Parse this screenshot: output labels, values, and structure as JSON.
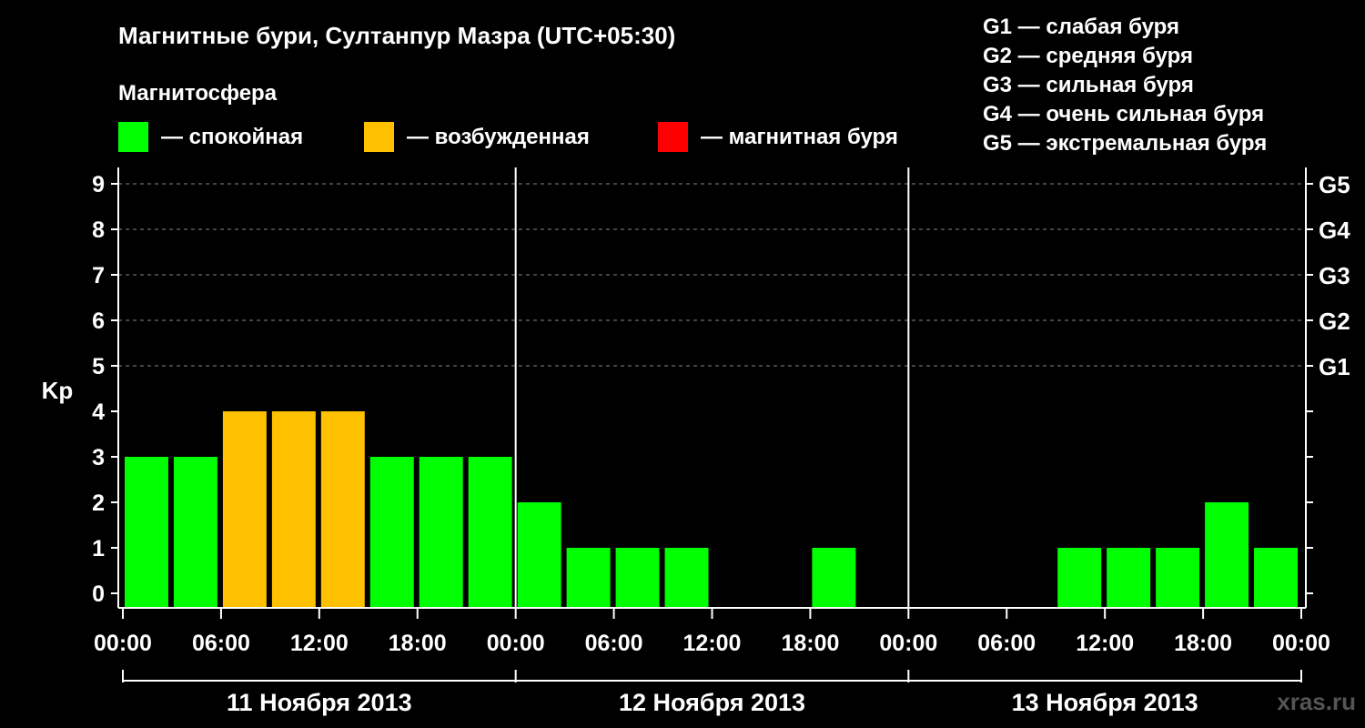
{
  "chart_data": {
    "type": "bar",
    "title": "Магнитные бури, Султанпур Мазра (UTC+05:30)",
    "legend_title": "Магнитосфера",
    "legend": [
      {
        "label": "— спокойная",
        "color": "#00ff00"
      },
      {
        "label": "— возбужденная",
        "color": "#ffc000"
      },
      {
        "label": "— магнитная буря",
        "color": "#ff0000"
      }
    ],
    "g_scale": [
      {
        "code": "G1",
        "text": "G1 — слабая буря",
        "kp": 5
      },
      {
        "code": "G2",
        "text": "G2 — средняя буря",
        "kp": 6
      },
      {
        "code": "G3",
        "text": "G3 — сильная буря",
        "kp": 7
      },
      {
        "code": "G4",
        "text": "G4 — очень сильная буря",
        "kp": 8
      },
      {
        "code": "G5",
        "text": "G5 — экстремальная буря",
        "kp": 9
      }
    ],
    "ylabel": "Kp",
    "ylim": [
      0,
      9
    ],
    "yticks": [
      "0",
      "1",
      "2",
      "3",
      "4",
      "5",
      "6",
      "7",
      "8",
      "9"
    ],
    "xticks": [
      "00:00",
      "06:00",
      "12:00",
      "18:00",
      "00:00",
      "06:00",
      "12:00",
      "18:00",
      "00:00",
      "06:00",
      "12:00",
      "18:00",
      "00:00"
    ],
    "days": [
      "11 Ноября 2013",
      "12 Ноября 2013",
      "13 Ноября 2013"
    ],
    "interval_hours": 3,
    "values": [
      3,
      3,
      4,
      4,
      4,
      3,
      3,
      3,
      2,
      1,
      1,
      1,
      0,
      0,
      1,
      0,
      0,
      0,
      0,
      1,
      1,
      1,
      2,
      1
    ],
    "colors": [
      "#00ff00",
      "#00ff00",
      "#ffc000",
      "#ffc000",
      "#ffc000",
      "#00ff00",
      "#00ff00",
      "#00ff00",
      "#00ff00",
      "#00ff00",
      "#00ff00",
      "#00ff00",
      "#00ff00",
      "#00ff00",
      "#00ff00",
      "#00ff00",
      "#00ff00",
      "#00ff00",
      "#00ff00",
      "#00ff00",
      "#00ff00",
      "#00ff00",
      "#00ff00",
      "#00ff00"
    ],
    "grid": true
  },
  "watermark": "xras.ru"
}
